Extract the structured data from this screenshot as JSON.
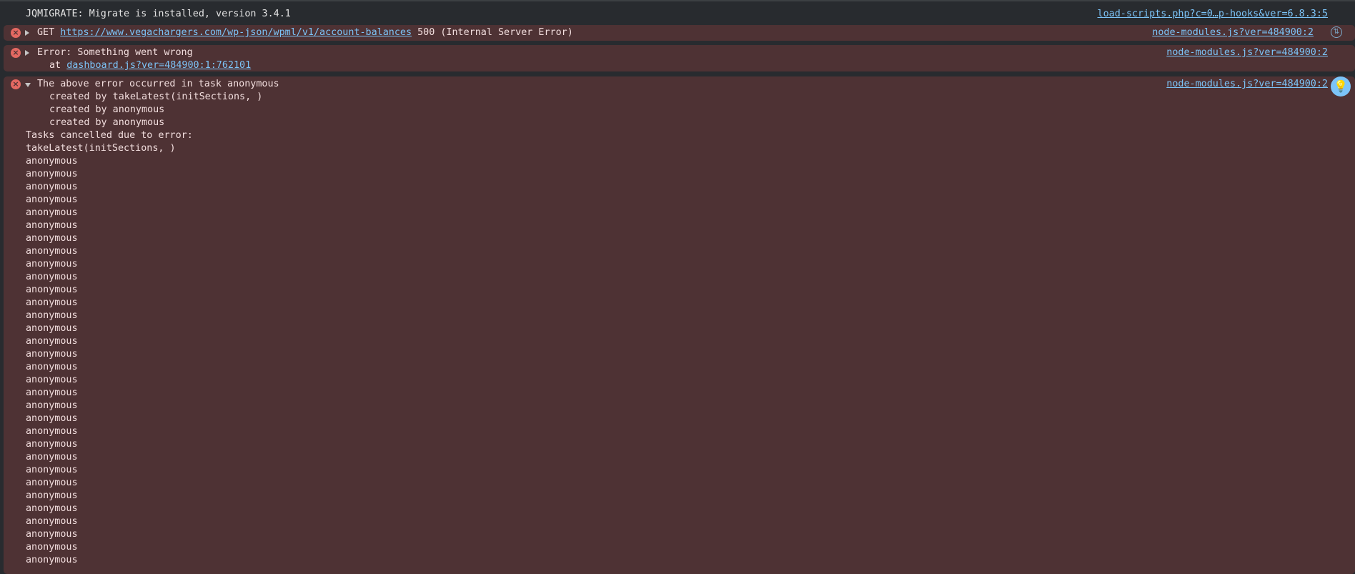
{
  "messages": [
    {
      "text": "JQMIGRATE: Migrate is installed, version 3.4.1",
      "source": "load-scripts.php?c=0…p-hooks&ver=6.8.3:5"
    },
    {
      "method": "GET",
      "url": "https://www.vegachargers.com/wp-json/wpml/v1/account-balances",
      "status": "500 (Internal Server Error)",
      "source": "node-modules.js?ver=484900:2",
      "icon": "network-icon"
    },
    {
      "text": "Error: Something went wrong",
      "at_label": "at",
      "at_link": "dashboard.js?ver=484900:1:762101",
      "source": "node-modules.js?ver=484900:2"
    },
    {
      "text": "The above error occurred in task anonymous",
      "source": "node-modules.js?ver=484900:2",
      "created_by": [
        "created by takeLatest(initSections, )",
        "created by anonymous",
        "created by anonymous"
      ],
      "cancelled_header": "Tasks cancelled due to error:",
      "cancelled": [
        "takeLatest(initSections, )",
        "anonymous",
        "anonymous",
        "anonymous",
        "anonymous",
        "anonymous",
        "anonymous",
        "anonymous",
        "anonymous",
        "anonymous",
        "anonymous",
        "anonymous",
        "anonymous",
        "anonymous",
        "anonymous",
        "anonymous",
        "anonymous",
        "anonymous",
        "anonymous",
        "anonymous",
        "anonymous",
        "anonymous",
        "anonymous",
        "anonymous",
        "anonymous",
        "anonymous",
        "anonymous",
        "anonymous",
        "anonymous",
        "anonymous",
        "anonymous",
        "anonymous",
        "anonymous"
      ]
    }
  ],
  "icons": {
    "error": "error-icon",
    "insights": "ai-insights-lightbulb-icon"
  },
  "colors": {
    "error_bg": "#4e3234",
    "link": "#7cc4f8",
    "error_icon": "#e46962"
  }
}
